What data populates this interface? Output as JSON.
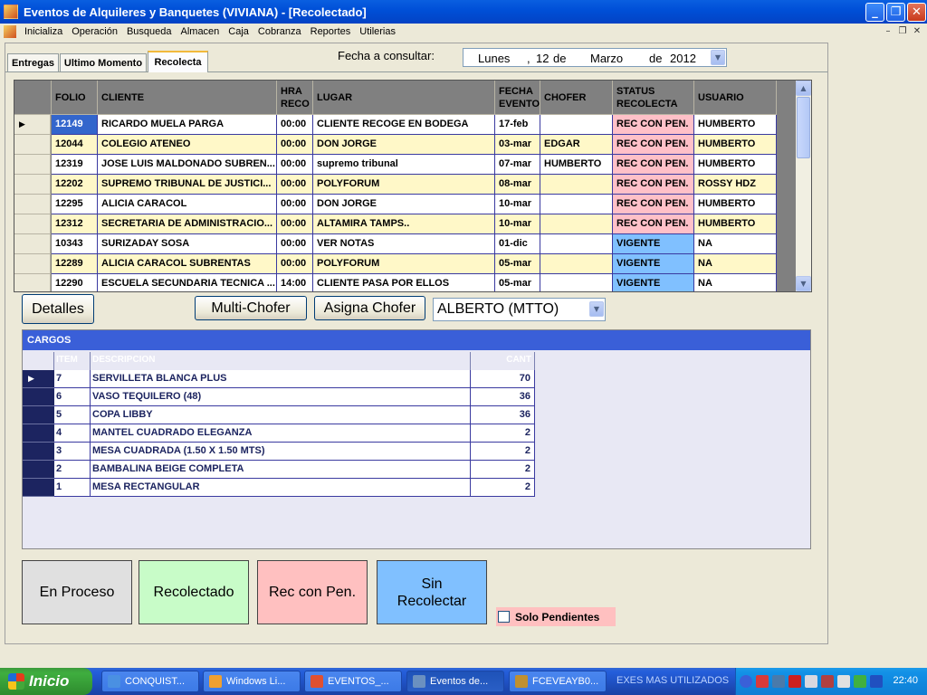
{
  "window": {
    "title": "Eventos de Alquileres y Banquetes  (VIVIANA) - [Recolectado]",
    "minimize": "_",
    "restore": "❐",
    "close": "✕"
  },
  "menu": [
    "Inicializa",
    "Operación",
    "Busqueda",
    "Almacen",
    "Caja",
    "Cobranza",
    "Reportes",
    "Utilerias"
  ],
  "mdi_controls": {
    "minimize": "–",
    "restore": "❐",
    "close": "✕"
  },
  "tabs": [
    "Entregas",
    "Ultimo Momento",
    "Recolecta"
  ],
  "active_tab": "Recolecta",
  "fecha": {
    "label": "Fecha a consultar:",
    "day_name": "Lunes",
    "sep": ",",
    "day": "12",
    "de1": "de",
    "month": "Marzo",
    "de2": "de",
    "year": "2012"
  },
  "grid": {
    "columns": [
      "FOLIO",
      "CLIENTE",
      "HRA RECO",
      "LUGAR",
      "FECHA EVENTO",
      "CHOFER",
      "STATUS RECOLECTA",
      "USUARIO"
    ],
    "rows": [
      {
        "folio": "12149",
        "cliente": "RICARDO MUELA PARGA",
        "hra": "00:00",
        "lugar": "CLIENTE RECOGE EN BODEGA",
        "fecha": "17-feb",
        "chofer": "",
        "status": "REC CON PEN.",
        "usuario": "HUMBERTO"
      },
      {
        "folio": "12044",
        "cliente": "COLEGIO ATENEO",
        "hra": "00:00",
        "lugar": "DON JORGE",
        "fecha": "03-mar",
        "chofer": "EDGAR",
        "status": "REC CON PEN.",
        "usuario": "HUMBERTO"
      },
      {
        "folio": "12319",
        "cliente": "JOSE LUIS MALDONADO SUBREN...",
        "hra": "00:00",
        "lugar": "supremo tribunal",
        "fecha": "07-mar",
        "chofer": "HUMBERTO",
        "status": "REC CON PEN.",
        "usuario": "HUMBERTO"
      },
      {
        "folio": "12202",
        "cliente": "SUPREMO TRIBUNAL DE JUSTICI...",
        "hra": "00:00",
        "lugar": "POLYFORUM",
        "fecha": "08-mar",
        "chofer": "",
        "status": "REC CON PEN.",
        "usuario": "ROSSY HDZ"
      },
      {
        "folio": "12295",
        "cliente": "ALICIA CARACOL",
        "hra": "00:00",
        "lugar": "DON JORGE",
        "fecha": "10-mar",
        "chofer": "",
        "status": "REC CON PEN.",
        "usuario": "HUMBERTO"
      },
      {
        "folio": "12312",
        "cliente": "SECRETARIA DE ADMINISTRACIO...",
        "hra": "00:00",
        "lugar": "ALTAMIRA TAMPS..",
        "fecha": "10-mar",
        "chofer": "",
        "status": "REC CON PEN.",
        "usuario": "HUMBERTO"
      },
      {
        "folio": "10343",
        "cliente": "SURIZADAY SOSA",
        "hra": "00:00",
        "lugar": "VER NOTAS",
        "fecha": "01-dic",
        "chofer": "",
        "status": "VIGENTE",
        "usuario": "NA"
      },
      {
        "folio": "12289",
        "cliente": "ALICIA CARACOL SUBRENTAS",
        "hra": "00:00",
        "lugar": "POLYFORUM",
        "fecha": "05-mar",
        "chofer": "",
        "status": "VIGENTE",
        "usuario": "NA"
      },
      {
        "folio": "12290",
        "cliente": "ESCUELA SECUNDARIA TECNICA ...",
        "hra": "14:00",
        "lugar": "CLIENTE PASA POR ELLOS",
        "fecha": "05-mar",
        "chofer": "",
        "status": "VIGENTE",
        "usuario": "NA"
      }
    ]
  },
  "buttons": {
    "detalles": "Detalles",
    "multi_chofer": "Multi-Chofer",
    "asigna_chofer": "Asigna Chofer"
  },
  "chofer_select": {
    "value": "ALBERTO (MTTO)"
  },
  "cargos": {
    "title": "CARGOS",
    "columns": [
      "ITEM",
      "DESCRIPCION",
      "CANT"
    ],
    "rows": [
      {
        "item": "7",
        "descripcion": "SERVILLETA BLANCA PLUS",
        "cant": "70"
      },
      {
        "item": "6",
        "descripcion": "VASO TEQUILERO (48)",
        "cant": "36"
      },
      {
        "item": "5",
        "descripcion": "COPA  LIBBY",
        "cant": "36"
      },
      {
        "item": "4",
        "descripcion": "MANTEL CUADRADO ELEGANZA",
        "cant": "2"
      },
      {
        "item": "3",
        "descripcion": "MESA CUADRADA (1.50 X 1.50 MTS)",
        "cant": "2"
      },
      {
        "item": "2",
        "descripcion": "BAMBALINA BEIGE COMPLETA",
        "cant": "2"
      },
      {
        "item": "1",
        "descripcion": "MESA RECTANGULAR",
        "cant": "2"
      }
    ]
  },
  "status_buttons": [
    {
      "label": "En Proceso",
      "color": "#e0e0e0"
    },
    {
      "label": "Recolectado",
      "color": "#c8fcc8"
    },
    {
      "label": "Rec con Pen.",
      "color": "#ffc0c0"
    },
    {
      "label": "Sin Recolectar",
      "color": "#80c0ff"
    }
  ],
  "solo_pendientes": {
    "label": "Solo Pendientes",
    "checked": false
  },
  "colors": {
    "row_white": "#ffffff",
    "row_yellow": "#fff8c8",
    "status_pending": "#ffc0c8",
    "status_vigente": "#80c0ff",
    "selected_folio": "#3366cc"
  },
  "taskbar": {
    "start": "Inicio",
    "tasks": [
      "CONQUIST...",
      "Windows Li...",
      "EVENTOS_...",
      "Eventos de...",
      "FCEVEAYB0..."
    ],
    "quick_launch": "EXES MAS UTILIZADOS",
    "chevron": "»",
    "clock": "22:40"
  }
}
